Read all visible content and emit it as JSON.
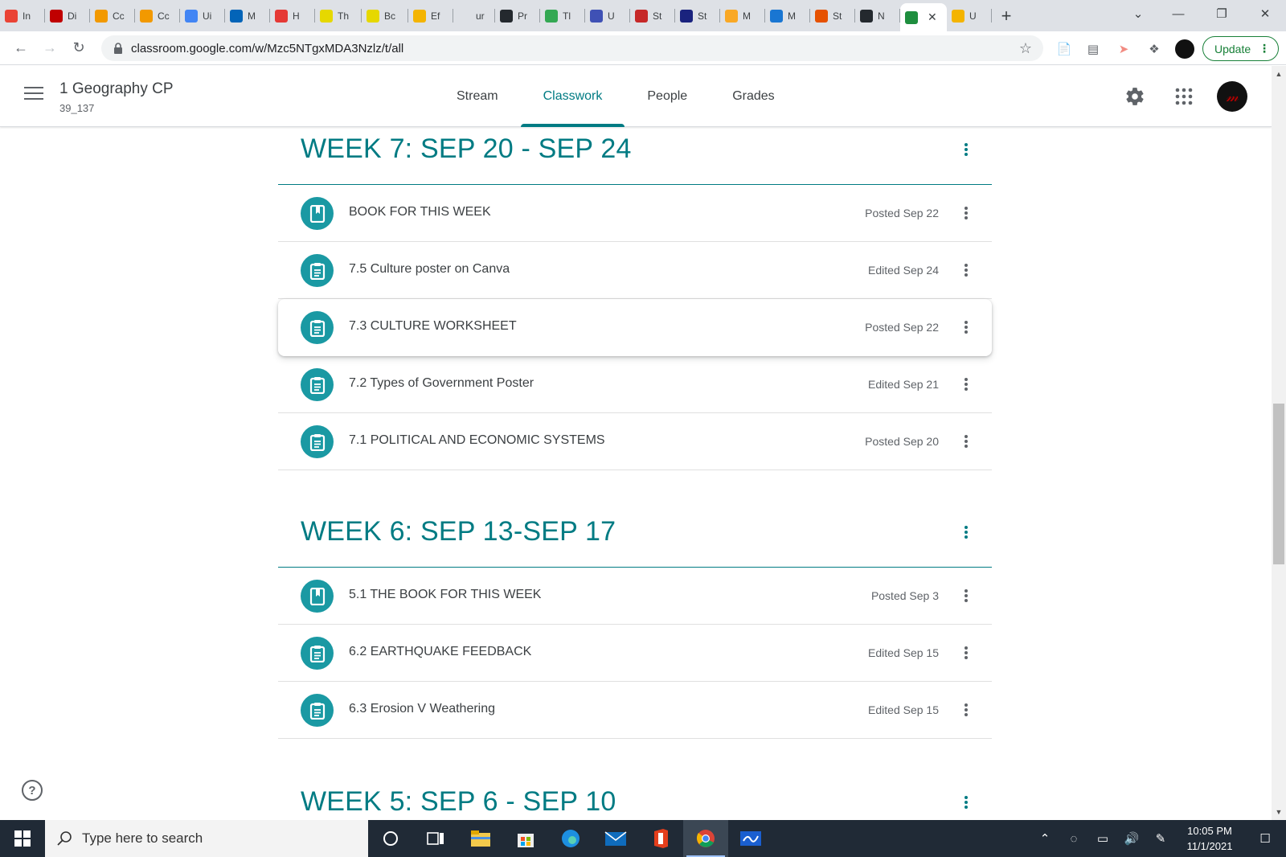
{
  "browser": {
    "tabs": [
      {
        "label": "In",
        "icon": "gmail-icon",
        "color": "#ea4335"
      },
      {
        "label": "Di",
        "icon": "ms-icon",
        "color": "#c00000"
      },
      {
        "label": "Cc",
        "icon": "pencil-icon",
        "color": "#f29900"
      },
      {
        "label": "Cc",
        "icon": "pencil-icon",
        "color": "#f29900"
      },
      {
        "label": "Ui",
        "icon": "docs-icon",
        "color": "#4285f4"
      },
      {
        "label": "M",
        "icon": "outlook-icon",
        "color": "#0364b8"
      },
      {
        "label": "H",
        "icon": "h-icon",
        "color": "#e53935"
      },
      {
        "label": "Th",
        "icon": "v-icon",
        "color": "#e6d800"
      },
      {
        "label": "Bc",
        "icon": "v-icon",
        "color": "#e6d800"
      },
      {
        "label": "Ef",
        "icon": "gear-icon",
        "color": "#f4b400"
      },
      {
        "label": "ur",
        "icon": "blank-icon",
        "color": "#dee1e6"
      },
      {
        "label": "Pr",
        "icon": "github-icon",
        "color": "#24292e"
      },
      {
        "label": "Tl",
        "icon": "diamond-icon",
        "color": "#34a853"
      },
      {
        "label": "U",
        "icon": "plus-icon",
        "color": "#3f51b5"
      },
      {
        "label": "St",
        "icon": "flag-icon",
        "color": "#c62828"
      },
      {
        "label": "St",
        "icon": "star-icon",
        "color": "#1a237e"
      },
      {
        "label": "M",
        "icon": "w-icon",
        "color": "#f9a825"
      },
      {
        "label": "M",
        "icon": "pen-icon",
        "color": "#1976d2"
      },
      {
        "label": "St",
        "icon": "r-icon",
        "color": "#e65100"
      },
      {
        "label": "N",
        "icon": "github-icon",
        "color": "#24292e"
      },
      {
        "label": "",
        "icon": "classroom-icon",
        "color": "#1e8e3e",
        "active": true
      },
      {
        "label": "U",
        "icon": "slides-icon",
        "color": "#f4b400"
      }
    ],
    "url": "classroom.google.com/w/Mzc5NTgxMDA3Nzlz/t/all",
    "update_label": "Update"
  },
  "header": {
    "class_name": "1 Geography CP",
    "class_section": "39_137",
    "tabs": [
      "Stream",
      "Classwork",
      "People",
      "Grades"
    ],
    "active_tab": "Classwork",
    "accent": "#007b83"
  },
  "topics": [
    {
      "title": "WEEK 7: SEP 20 - SEP 24",
      "items": [
        {
          "title": "BOOK FOR THIS WEEK",
          "date": "Posted Sep 22",
          "kind": "material"
        },
        {
          "title": "7.5 Culture poster on Canva",
          "date": "Edited Sep 24",
          "kind": "assignment"
        },
        {
          "title": "7.3 CULTURE WORKSHEET",
          "date": "Posted Sep 22",
          "kind": "assignment"
        },
        {
          "title": "7.2 Types of Government Poster",
          "date": "Edited Sep 21",
          "kind": "assignment"
        },
        {
          "title": "7.1 POLITICAL AND ECONOMIC SYSTEMS",
          "date": "Posted Sep 20",
          "kind": "assignment"
        }
      ]
    },
    {
      "title": "WEEK 6: SEP 13-SEP 17",
      "items": [
        {
          "title": "5.1 THE BOOK FOR THIS WEEK",
          "date": "Posted Sep 3",
          "kind": "material"
        },
        {
          "title": "6.2 EARTHQUAKE FEEDBACK",
          "date": "Edited Sep 15",
          "kind": "assignment"
        },
        {
          "title": "6.3 Erosion V Weathering",
          "date": "Edited Sep 15",
          "kind": "assignment"
        }
      ]
    },
    {
      "title": "WEEK 5: SEP 6 - SEP 10",
      "items": []
    }
  ],
  "help_label": "?",
  "taskbar": {
    "search_placeholder": "Type here to search",
    "time": "10:05 PM",
    "date": "11/1/2021"
  }
}
